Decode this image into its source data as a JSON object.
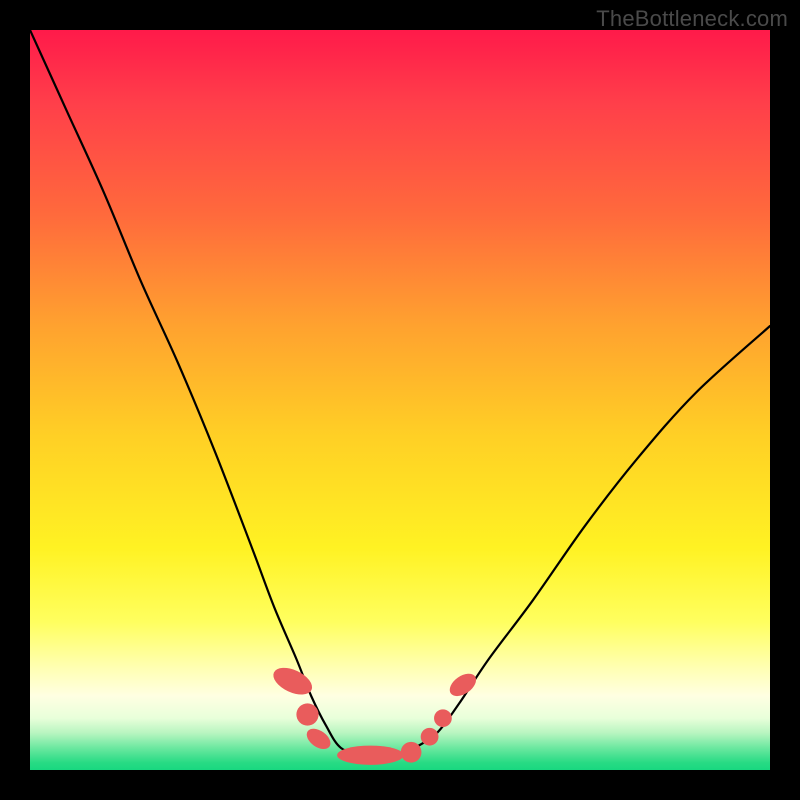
{
  "watermark": {
    "text": "TheBottleneck.com"
  },
  "colors": {
    "frame": "#000000",
    "curve_stroke": "#000000",
    "marker_fill": "#e95c5c",
    "marker_stroke": "#d24a4a"
  },
  "chart_data": {
    "type": "line",
    "title": "",
    "xlabel": "",
    "ylabel": "",
    "xlim": [
      0,
      100
    ],
    "ylim": [
      0,
      100
    ],
    "grid": false,
    "legend": false,
    "description": "V-shaped bottleneck curve over a red→green vertical heat gradient. Y scale: top (100) = high bottleneck (red), bottom (0) = no bottleneck (green). Minimum plateau around x=42–52.",
    "series": [
      {
        "name": "bottleneck-curve",
        "x": [
          0,
          5,
          10,
          15,
          20,
          25,
          30,
          33,
          36,
          38,
          40,
          42,
          45,
          48,
          50,
          52,
          55,
          58,
          62,
          68,
          75,
          82,
          90,
          100
        ],
        "y": [
          100,
          89,
          78,
          66,
          55,
          43,
          30,
          22,
          15,
          10,
          6,
          3,
          2,
          2,
          2,
          3,
          5,
          9,
          15,
          23,
          33,
          42,
          51,
          60
        ]
      }
    ],
    "markers": [
      {
        "shape": "pill",
        "cx": 35.5,
        "cy": 12.0,
        "rx": 1.5,
        "ry": 2.8,
        "angle": -65
      },
      {
        "shape": "circle",
        "cx": 37.5,
        "cy": 7.5,
        "r": 1.5
      },
      {
        "shape": "pill",
        "cx": 39.0,
        "cy": 4.2,
        "rx": 1.1,
        "ry": 1.8,
        "angle": -55
      },
      {
        "shape": "pill",
        "cx": 46.0,
        "cy": 2.0,
        "rx": 4.5,
        "ry": 1.3,
        "angle": 0
      },
      {
        "shape": "circle",
        "cx": 51.5,
        "cy": 2.4,
        "r": 1.4
      },
      {
        "shape": "circle",
        "cx": 54.0,
        "cy": 4.5,
        "r": 1.2
      },
      {
        "shape": "circle",
        "cx": 55.8,
        "cy": 7.0,
        "r": 1.2
      },
      {
        "shape": "pill",
        "cx": 58.5,
        "cy": 11.5,
        "rx": 1.2,
        "ry": 2.0,
        "angle": 55
      }
    ]
  }
}
